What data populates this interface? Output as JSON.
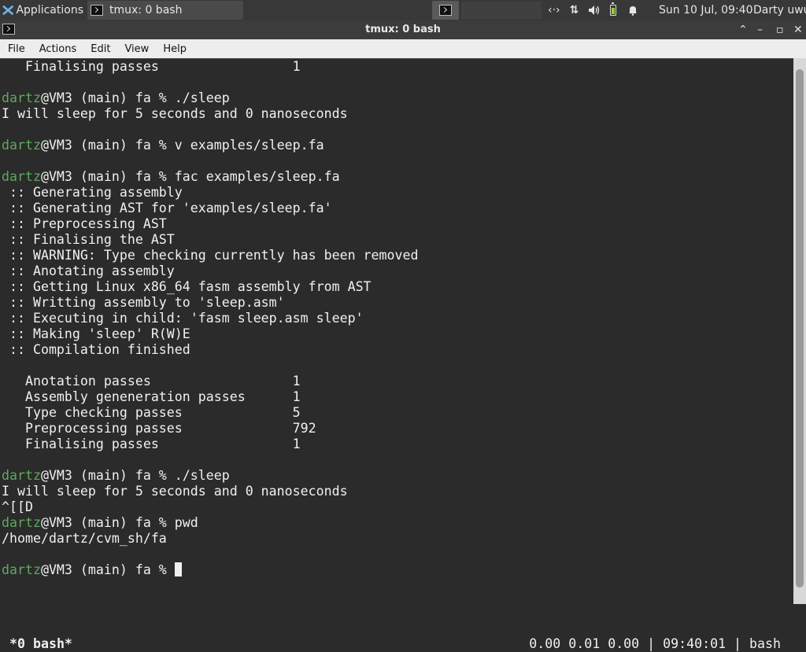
{
  "panel": {
    "applications_label": "Applications",
    "task_label": "tmux: 0 bash",
    "clock": "Sun 10 Jul, 09:40",
    "user": "Darty uwu",
    "tray_icons": [
      "network-activity-icon",
      "network-transfer-icon",
      "volume-icon",
      "battery-icon",
      "notification-bell-icon"
    ]
  },
  "window": {
    "title": "tmux: 0 bash"
  },
  "menu": {
    "items": [
      "File",
      "Actions",
      "Edit",
      "View",
      "Help"
    ]
  },
  "terminal": {
    "prompt_user": "dartz",
    "prompt_rest": "@VM3 (main) fa % ",
    "lines": [
      {
        "type": "text",
        "text": "   Finalising passes                 1"
      },
      {
        "type": "text",
        "text": ""
      },
      {
        "type": "prompt",
        "cmd": "./sleep"
      },
      {
        "type": "text",
        "text": "I will sleep for 5 seconds and 0 nanoseconds"
      },
      {
        "type": "text",
        "text": ""
      },
      {
        "type": "prompt",
        "cmd": "v examples/sleep.fa"
      },
      {
        "type": "text",
        "text": ""
      },
      {
        "type": "prompt",
        "cmd": "fac examples/sleep.fa"
      },
      {
        "type": "text",
        "text": " :: Generating assembly"
      },
      {
        "type": "text",
        "text": " :: Generating AST for 'examples/sleep.fa'"
      },
      {
        "type": "text",
        "text": " :: Preprocessing AST"
      },
      {
        "type": "text",
        "text": " :: Finalising the AST"
      },
      {
        "type": "text",
        "text": " :: WARNING: Type checking currently has been removed"
      },
      {
        "type": "text",
        "text": " :: Anotating assembly"
      },
      {
        "type": "text",
        "text": " :: Getting Linux x86_64 fasm assembly from AST"
      },
      {
        "type": "text",
        "text": " :: Writting assembly to 'sleep.asm'"
      },
      {
        "type": "text",
        "text": " :: Executing in child: 'fasm sleep.asm sleep'"
      },
      {
        "type": "text",
        "text": " :: Making 'sleep' R(W)E"
      },
      {
        "type": "text",
        "text": " :: Compilation finished"
      },
      {
        "type": "text",
        "text": ""
      },
      {
        "type": "text",
        "text": "   Anotation passes                  1"
      },
      {
        "type": "text",
        "text": "   Assembly geneneration passes      1"
      },
      {
        "type": "text",
        "text": "   Type checking passes              5"
      },
      {
        "type": "text",
        "text": "   Preprocessing passes              792"
      },
      {
        "type": "text",
        "text": "   Finalising passes                 1"
      },
      {
        "type": "text",
        "text": ""
      },
      {
        "type": "prompt",
        "cmd": "./sleep"
      },
      {
        "type": "text",
        "text": "I will sleep for 5 seconds and 0 nanoseconds"
      },
      {
        "type": "text",
        "text": "^[[D"
      },
      {
        "type": "prompt",
        "cmd": "pwd"
      },
      {
        "type": "text",
        "text": "/home/dartz/cvm_sh/fa"
      },
      {
        "type": "text",
        "text": ""
      },
      {
        "type": "prompt",
        "cmd": "",
        "cursor": true
      }
    ]
  },
  "tmux_status": {
    "window": "*0 bash*",
    "right": "0.00 0.01 0.00 | 09:40:01 | bash"
  },
  "scrollbar": {
    "thumb_start_fraction": 0.02,
    "thumb_end_fraction": 0.97
  }
}
